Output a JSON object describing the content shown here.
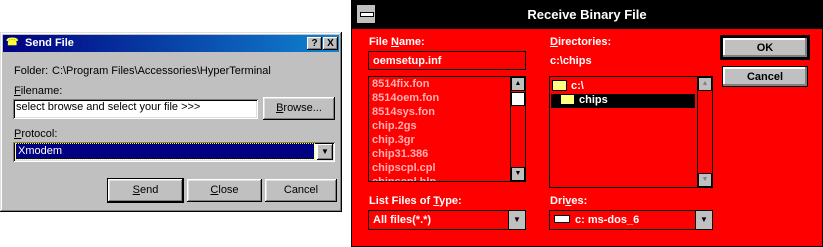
{
  "send_file": {
    "title": "Send File",
    "help_btn": "?",
    "close_btn": "X",
    "folder_label": "Folder:",
    "folder_path": "C:\\Program Files\\Accessories\\HyperTerminal",
    "filename_label": "Filename:",
    "filename_value": "select browse and select your file >>>",
    "browse_label": "Browse...",
    "protocol_label": "Protocol:",
    "protocol_value": "Xmodem",
    "send_label": "Send",
    "close_label": "Close",
    "cancel_label": "Cancel"
  },
  "receive_binary": {
    "title": "Receive Binary File",
    "file_name_label": "File Name:",
    "file_name_value": "oemsetup.inf",
    "files": [
      "8514fix.fon",
      "8514oem.fon",
      "8514sys.fon",
      "chip.2gs",
      "chip.3gr",
      "chip31.386",
      "chipscpl.cpl",
      "chipscpl.hlp"
    ],
    "directories_label": "Directories:",
    "current_dir": "c:\\chips",
    "dirs": [
      {
        "name": "c:\\",
        "selected": false
      },
      {
        "name": "chips",
        "selected": true
      }
    ],
    "ok_label": "OK",
    "cancel_label": "Cancel",
    "list_type_label": "List Files of Type:",
    "list_type_value": "All files(*.*)",
    "drives_label": "Drives:",
    "drives_value": "c: ms-dos_6"
  }
}
